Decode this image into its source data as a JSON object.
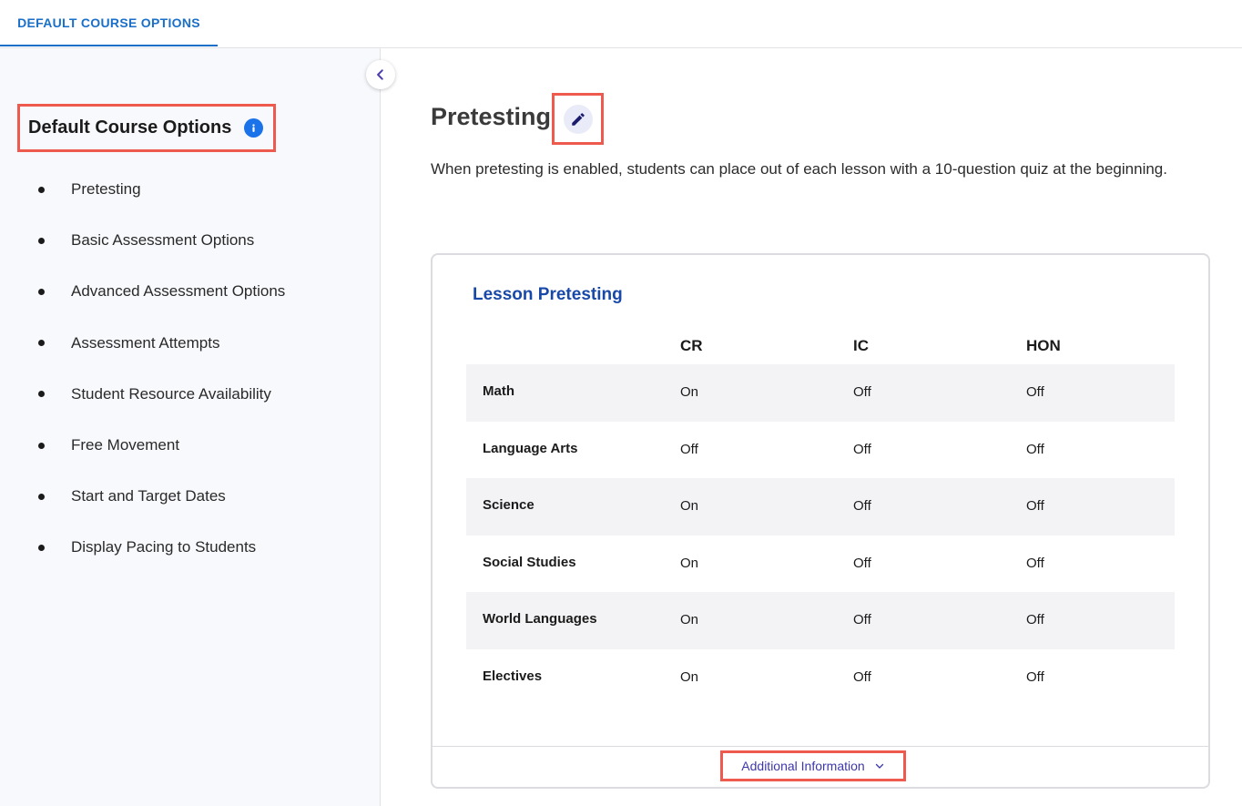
{
  "header": {
    "tab_label": "DEFAULT COURSE OPTIONS"
  },
  "sidebar": {
    "title": "Default Course Options",
    "items": [
      {
        "label": "Pretesting"
      },
      {
        "label": "Basic Assessment Options"
      },
      {
        "label": "Advanced Assessment Options"
      },
      {
        "label": "Assessment Attempts"
      },
      {
        "label": "Student Resource Availability"
      },
      {
        "label": "Free Movement"
      },
      {
        "label": "Start and Target Dates"
      },
      {
        "label": "Display Pacing to Students"
      }
    ]
  },
  "main": {
    "heading": "Pretesting",
    "description": "When pretesting is enabled, students can place out of each lesson with a 10-question quiz at the beginning.",
    "card": {
      "title": "Lesson Pretesting",
      "columns": [
        "CR",
        "IC",
        "HON"
      ],
      "rows": [
        {
          "subject": "Math",
          "values": [
            "On",
            "Off",
            "Off"
          ]
        },
        {
          "subject": "Language Arts",
          "values": [
            "Off",
            "Off",
            "Off"
          ]
        },
        {
          "subject": "Science",
          "values": [
            "On",
            "Off",
            "Off"
          ]
        },
        {
          "subject": "Social Studies",
          "values": [
            "On",
            "Off",
            "Off"
          ]
        },
        {
          "subject": "World Languages",
          "values": [
            "On",
            "Off",
            "Off"
          ]
        },
        {
          "subject": "Electives",
          "values": [
            "On",
            "Off",
            "Off"
          ]
        }
      ],
      "footer_link": "Additional Information"
    }
  },
  "icons": {
    "collapse": "chevron-left-icon",
    "info": "info-icon",
    "edit": "pencil-icon",
    "expand": "chevron-down-icon"
  },
  "colors": {
    "accent_blue": "#1a6fc9",
    "card_title": "#1949a8",
    "highlight_border": "#ef5a4f",
    "link_purple": "#3e37a8"
  }
}
